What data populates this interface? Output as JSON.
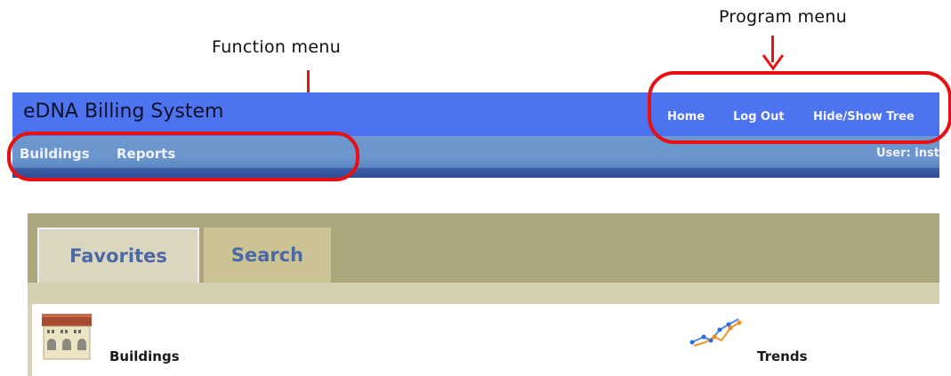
{
  "annotations": {
    "function_menu_label": "Function menu",
    "program_menu_label": "Program menu"
  },
  "app": {
    "title": "eDNA Billing System"
  },
  "program_menu": {
    "items": [
      {
        "label": "Home"
      },
      {
        "label": "Log Out"
      },
      {
        "label": "Hide/Show Tree"
      }
    ]
  },
  "function_menu": {
    "items": [
      {
        "label": "Buildings"
      },
      {
        "label": "Reports"
      }
    ]
  },
  "user": {
    "label": "User: inste"
  },
  "tabs": [
    {
      "label": "Favorites",
      "active": true
    },
    {
      "label": "Search",
      "active": false
    }
  ],
  "widgets": [
    {
      "label": "Buildings",
      "icon": "building-icon"
    },
    {
      "label": "Trends",
      "icon": "trend-chart-icon"
    }
  ],
  "colors": {
    "header": "#4f74ef",
    "function_bar": "#6d98cf",
    "tab_text": "#4c69a6",
    "annotation_red": "#e81111"
  }
}
